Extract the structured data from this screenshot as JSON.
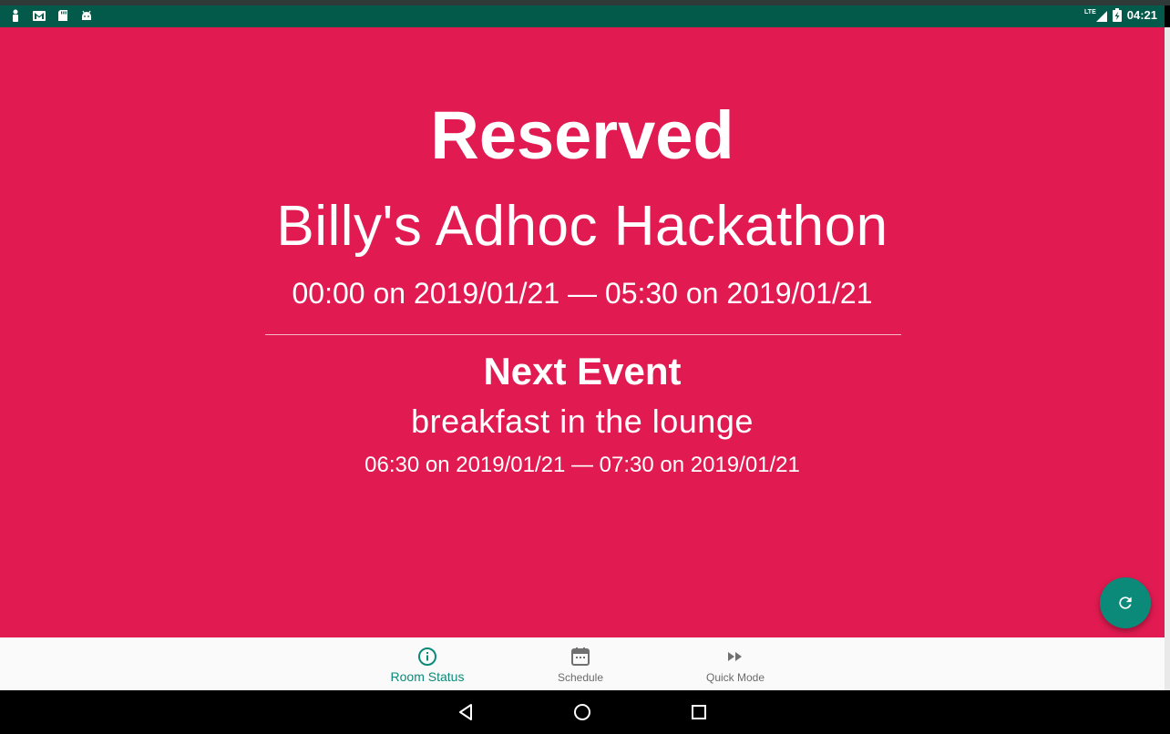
{
  "status_bar": {
    "network": "LTE",
    "time": "04:21",
    "notification_icons": [
      "accessibility-icon",
      "gmail-icon",
      "sd-card-icon",
      "android-icon"
    ]
  },
  "room": {
    "status": "Reserved",
    "current_event_title": "Billy's Adhoc Hackathon",
    "current_event_time": "00:00 on 2019/01/21 — 05:30 on 2019/01/21",
    "next_heading": "Next Event",
    "next_event_title": "breakfast in the lounge",
    "next_event_time": "06:30 on 2019/01/21 — 07:30 on 2019/01/21"
  },
  "fab": {
    "icon": "refresh-icon"
  },
  "bottom_nav": {
    "items": [
      {
        "label": "Room Status",
        "icon": "info-icon",
        "active": true
      },
      {
        "label": "Schedule",
        "icon": "calendar-icon",
        "active": false
      },
      {
        "label": "Quick Mode",
        "icon": "fast-forward-icon",
        "active": false
      }
    ]
  },
  "colors": {
    "reserved_background": "#e11b51",
    "status_bar": "#03594a",
    "accent": "#0b8a79",
    "nav_background": "#fafafa"
  }
}
